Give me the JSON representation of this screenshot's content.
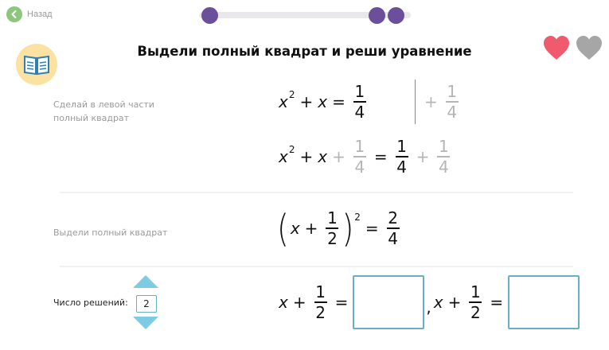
{
  "header": {
    "back_label": "Назад",
    "title": "Выдели полный квадрат и реши уравнение"
  },
  "colors": {
    "accent": "#6b4f9a",
    "heart_full": "#f05a6e",
    "heart_empty": "#a6a6a6",
    "input_border": "#67b0c2",
    "back_green": "#8ec57f"
  },
  "icons": {
    "back": "chevron-left-icon",
    "book": "book-icon",
    "heart": "heart-icon"
  },
  "lives": {
    "full": 1,
    "total": 2
  },
  "steps": {
    "step1": {
      "hint": "Сделай в левой части полный квадрат",
      "line1": {
        "var": "x",
        "exp": "2",
        "plus": "+",
        "var2": "x",
        "eq": "=",
        "num": "1",
        "den": "4"
      },
      "side_op": {
        "plus": "+",
        "num": "1",
        "den": "4"
      },
      "line2": {
        "var": "x",
        "exp": "2",
        "plus": "+",
        "var2": "x",
        "plus2": "+",
        "num1": "1",
        "den1": "4",
        "eq": "=",
        "num2": "1",
        "den2": "4",
        "plus3": "+",
        "num3": "1",
        "den3": "4"
      }
    },
    "step2": {
      "hint": "Выдели полный квадрат",
      "paren_open": "(",
      "var": "x",
      "plus": "+",
      "num": "1",
      "den": "2",
      "paren_close": ")",
      "exp": "2",
      "eq": "=",
      "rnum": "2",
      "rden": "4"
    },
    "step3": {
      "count_label": "Число решений:",
      "count_value": "2",
      "eq1": {
        "var": "x",
        "plus": "+",
        "num": "1",
        "den": "2",
        "eq": "="
      },
      "comma": ",",
      "eq2": {
        "var": "x",
        "plus": "+",
        "num": "1",
        "den": "2",
        "eq": "="
      }
    }
  }
}
